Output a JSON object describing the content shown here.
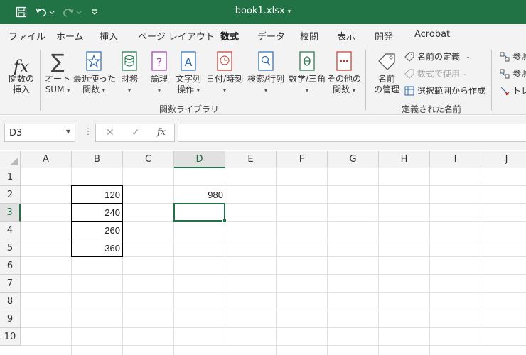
{
  "window": {
    "title": "book1.xlsx"
  },
  "tabs": [
    "ファイル",
    "ホーム",
    "挿入",
    "ページ レイアウト",
    "数式",
    "データ",
    "校閲",
    "表示",
    "開発",
    "Acrobat"
  ],
  "ribbon": {
    "buttons": [
      {
        "l1": "関数の",
        "l2": "挿入"
      },
      {
        "l1": "オート",
        "l2": "SUM"
      },
      {
        "l1": "最近使った",
        "l2": "関数"
      },
      {
        "l1": "財務",
        "l2": ""
      },
      {
        "l1": "論理",
        "l2": ""
      },
      {
        "l1": "文字列",
        "l2": "操作"
      },
      {
        "l1": "日付/時刻",
        "l2": ""
      },
      {
        "l1": "検索/行列",
        "l2": ""
      },
      {
        "l1": "数学/三角",
        "l2": ""
      },
      {
        "l1": "その他の",
        "l2": "関数"
      },
      {
        "l1": "名前",
        "l2": "の管理"
      }
    ],
    "groups": {
      "library": "関数ライブラリ",
      "names": "定義された名前"
    },
    "names_items": {
      "define": "名前の定義",
      "use_in_formula": "数式で使用",
      "create_from_selection": "選択範囲から作成"
    },
    "audit_items": {
      "precedents": "参照",
      "dependents": "参照",
      "trace": "トレ"
    }
  },
  "formula_bar": {
    "name_box": "D3",
    "fx": "fx",
    "formula": ""
  },
  "grid": {
    "columns": [
      "A",
      "B",
      "C",
      "D",
      "E",
      "F",
      "G",
      "H",
      "I",
      "J"
    ],
    "rows": [
      "1",
      "2",
      "3",
      "4",
      "5",
      "6",
      "7",
      "8",
      "9",
      "10"
    ],
    "selected_column": "D",
    "selected_row": "3",
    "cells": {
      "B2": "120",
      "B3": "240",
      "B4": "260",
      "B5": "360",
      "D2": "980"
    }
  },
  "colors": {
    "accent": "#217346",
    "ribbon_bg": "#f3f3f3",
    "grid_line": "#e1e1e1"
  }
}
